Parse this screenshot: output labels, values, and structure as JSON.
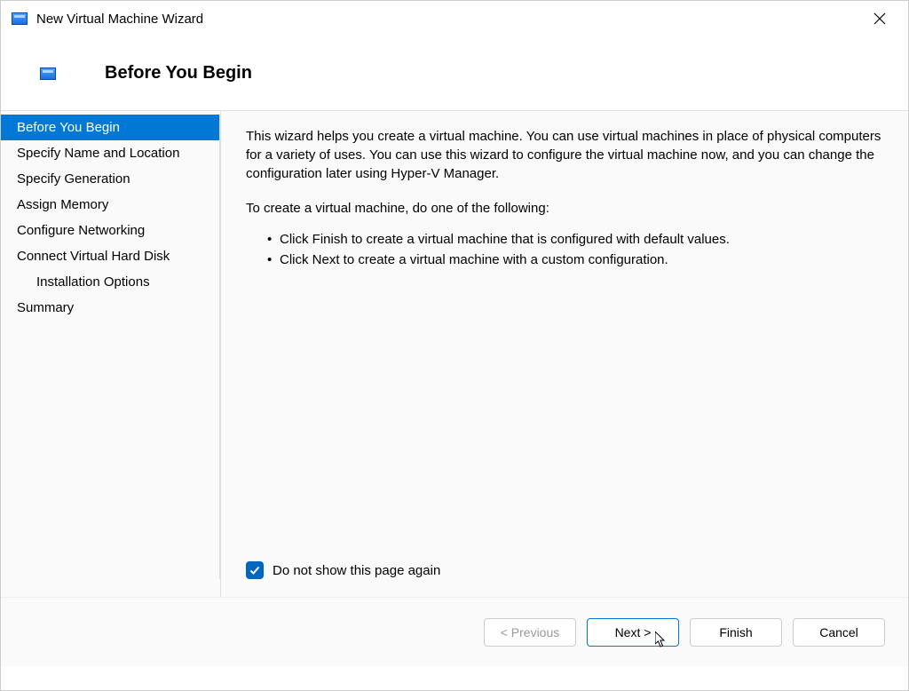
{
  "titlebar": {
    "title": "New Virtual Machine Wizard"
  },
  "header": {
    "title": "Before You Begin"
  },
  "sidebar": {
    "items": [
      {
        "label": "Before You Begin",
        "selected": true
      },
      {
        "label": "Specify Name and Location",
        "selected": false
      },
      {
        "label": "Specify Generation",
        "selected": false
      },
      {
        "label": "Assign Memory",
        "selected": false
      },
      {
        "label": "Configure Networking",
        "selected": false
      },
      {
        "label": "Connect Virtual Hard Disk",
        "selected": false
      },
      {
        "label": "Installation Options",
        "selected": false,
        "indent": true
      },
      {
        "label": "Summary",
        "selected": false
      }
    ]
  },
  "main": {
    "intro": "This wizard helps you create a virtual machine. You can use virtual machines in place of physical computers for a variety of uses. You can use this wizard to configure the virtual machine now, and you can change the configuration later using Hyper-V Manager.",
    "instruction": "To create a virtual machine, do one of the following:",
    "bullets": [
      "Click Finish to create a virtual machine that is configured with default values.",
      "Click Next to create a virtual machine with a custom configuration."
    ],
    "checkbox_label": "Do not show this page again",
    "checkbox_checked": true
  },
  "buttons": {
    "previous": "< Previous",
    "next": "Next >",
    "finish": "Finish",
    "cancel": "Cancel"
  }
}
